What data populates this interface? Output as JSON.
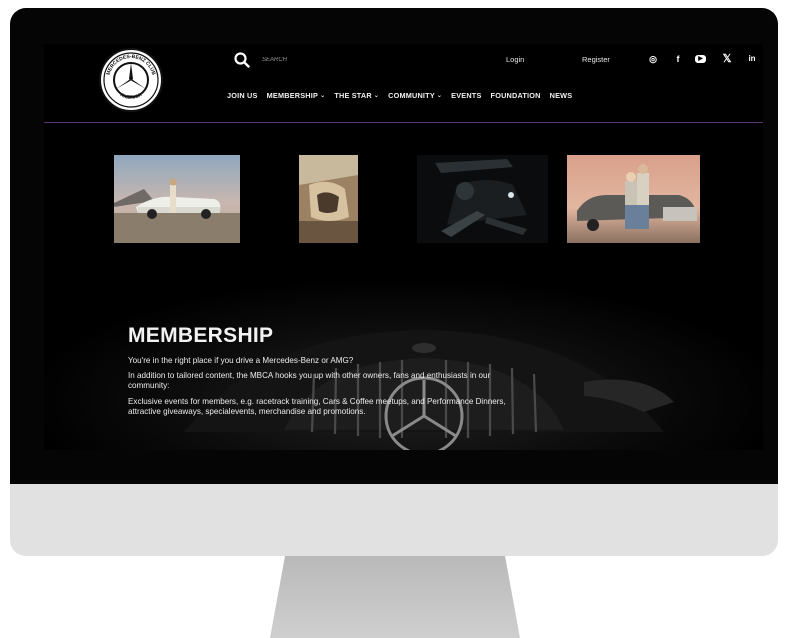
{
  "header": {
    "search_placeholder": "SEARCH",
    "login": "Login",
    "register": "Register",
    "social": [
      {
        "icon": "instagram-icon",
        "glyph": "◎"
      },
      {
        "icon": "facebook-icon",
        "glyph": "f"
      },
      {
        "icon": "youtube-icon",
        "glyph": "▶"
      },
      {
        "icon": "x-icon",
        "glyph": "𝕏"
      },
      {
        "icon": "linkedin-icon",
        "glyph": "in"
      }
    ],
    "nav": [
      {
        "label": "JOIN US",
        "dropdown": false
      },
      {
        "label": "MEMBERSHIP",
        "dropdown": true
      },
      {
        "label": "THE STAR",
        "dropdown": true
      },
      {
        "label": "COMMUNITY",
        "dropdown": true
      },
      {
        "label": "EVENTS",
        "dropdown": false
      },
      {
        "label": "FOUNDATION",
        "dropdown": false
      },
      {
        "label": "NEWS",
        "dropdown": false
      }
    ]
  },
  "logo": {
    "top_text": "MERCEDES-BENZ CLUB",
    "bottom_text": "AMERICA"
  },
  "membership": {
    "title": "MEMBERSHIP",
    "line1": "You're in the right place if you drive a Mercedes-Benz or AMG?",
    "line2a": "In addition to tailored content, the MBCA hooks you up with other owners, fans and enthusiasts in our",
    "line2b": "community:",
    "line3a": "Exclusive events for members, e.g. racetrack training, Cars & Coffee meetups, and Performance Dinners,",
    "line3b": "attractive giveaways, specialevents, merchandise and promotions."
  },
  "colors": {
    "accent_divider": "#5a3570",
    "screen_bg": "#000000",
    "bezel": "#050505",
    "chin": "#e1e1e1"
  }
}
